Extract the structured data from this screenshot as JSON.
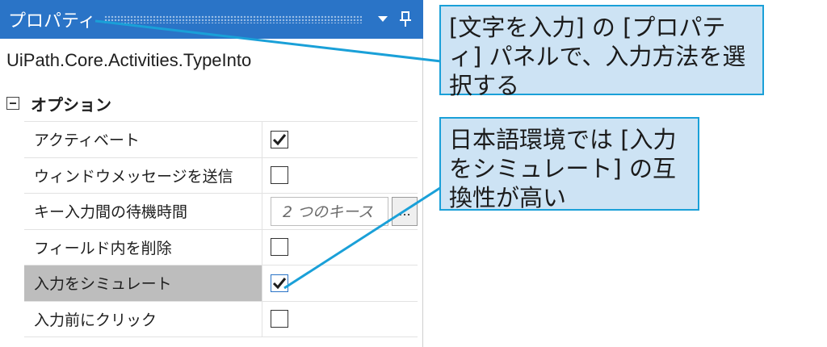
{
  "panel": {
    "title": "プロパティ",
    "activity_name": "UiPath.Core.Activities.TypeInto",
    "category": "オプション",
    "rows": [
      {
        "label": "アクティベート",
        "checked": true
      },
      {
        "label": "ウィンドウメッセージを送信",
        "checked": false
      },
      {
        "label": "キー入力間の待機時間",
        "value": "2 つのキース",
        "button": "..."
      },
      {
        "label": "フィールド内を削除",
        "checked": false
      },
      {
        "label": "入力をシミュレート",
        "checked": true
      },
      {
        "label": "入力前にクリック",
        "checked": false
      }
    ]
  },
  "callouts": [
    {
      "text": "[文字を入力] の [プロパティ] パネルで、入力方法を選択する"
    },
    {
      "text": "日本語環境では [入力をシミュレート] の互換性が高い"
    }
  ],
  "colors": {
    "titlebar": "#2a74c7",
    "callout_fill": "#cde3f4",
    "callout_border": "#1aa0d8",
    "selected_row": "#bdbdbd"
  },
  "icons": {
    "dropdown": "triangle-down-icon",
    "pin": "pin-icon",
    "check": "checkmark-icon"
  }
}
